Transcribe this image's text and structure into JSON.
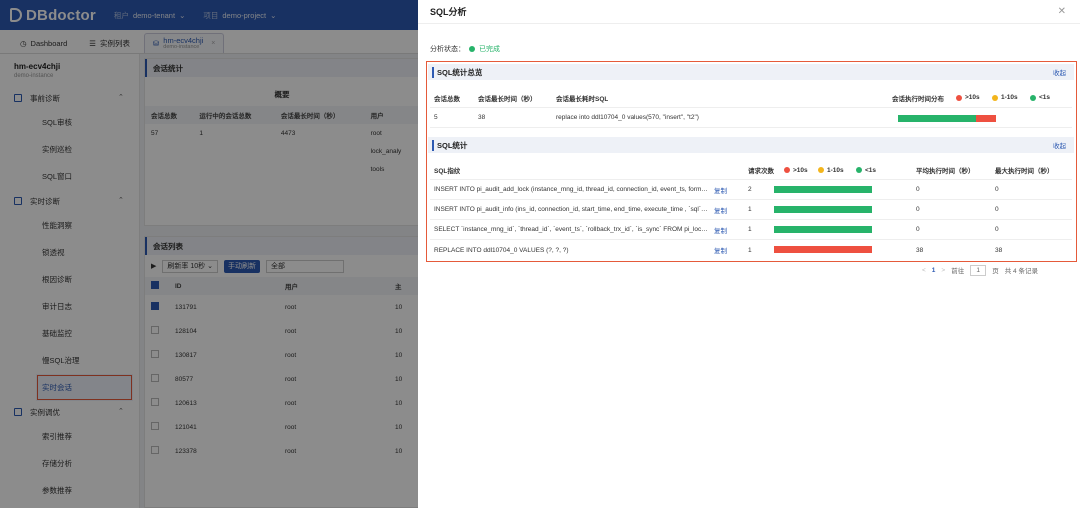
{
  "app": {
    "logo": "DBdoctor",
    "tenant_label": "租户",
    "tenant": "demo-tenant",
    "project_label": "项目",
    "project": "demo-project",
    "tabs": [
      {
        "label": "Dashboard"
      },
      {
        "label": "实例列表"
      },
      {
        "label": "hm-ecv4chji",
        "sub": "demo-instance"
      }
    ]
  },
  "sidebar": {
    "instance_name": "hm-ecv4chji",
    "instance_sub": "demo-instance",
    "groups": [
      {
        "label": "事前诊断",
        "items": [
          "SQL审核",
          "实例巡检",
          "SQL窗口"
        ]
      },
      {
        "label": "实时诊断",
        "items": [
          "性能洞察",
          "锁透视",
          "根因诊断",
          "审计日志",
          "基础监控",
          "慢SQL治理",
          "实时会话"
        ]
      },
      {
        "label": "实例调优",
        "items": [
          "索引推荐",
          "存储分析",
          "参数推荐"
        ]
      }
    ],
    "active_item": "实时会话"
  },
  "session_stats": {
    "title": "会话统计",
    "overview_label": "概要",
    "headers": [
      "会话总数",
      "运行中的会话总数",
      "会话最长时间（秒）",
      "用户"
    ],
    "values": [
      "57",
      "1",
      "4473",
      "root"
    ],
    "users": [
      "root",
      "lock_analy",
      "tools"
    ]
  },
  "session_list": {
    "title": "会话列表",
    "refresh_select": "刷新率 10秒",
    "manual_refresh": "手动刷新",
    "filter_select": "全部",
    "headers": [
      "ID",
      "用户",
      "主"
    ],
    "rows": [
      {
        "id": "131791",
        "user": "root",
        "host": "10",
        "checked": true
      },
      {
        "id": "128104",
        "user": "root",
        "host": "10",
        "checked": false
      },
      {
        "id": "130817",
        "user": "root",
        "host": "10",
        "checked": false
      },
      {
        "id": "80577",
        "user": "root",
        "host": "10",
        "checked": false
      },
      {
        "id": "120613",
        "user": "root",
        "host": "10",
        "checked": false
      },
      {
        "id": "121041",
        "user": "root",
        "host": "10",
        "checked": false
      },
      {
        "id": "123378",
        "user": "root",
        "host": "10",
        "checked": false
      }
    ]
  },
  "modal": {
    "title": "SQL分析",
    "status_label": "分析状态：",
    "status_value": "已完成",
    "overview": {
      "title": "SQL统计总览",
      "collapse": "收起",
      "headers": [
        "会话总数",
        "会话最长时间（秒）",
        "会话最长耗时SQL",
        "会话执行时间分布"
      ],
      "legend": [
        ">10s",
        "1-10s",
        "<1s"
      ],
      "row": {
        "total": "5",
        "max_time": "38",
        "sql": "replace into ddl10704_0 values(570, \"insert\", \"t2\")",
        "dist": {
          "green": 0.8,
          "red": 0.2
        }
      }
    },
    "sql_stats": {
      "title": "SQL统计",
      "collapse": "收起",
      "headers": [
        "SQL指纹",
        "请求次数",
        "平均执行时间（秒）",
        "最大执行时间（秒）"
      ],
      "copy_label": "复制",
      "rows": [
        {
          "sql": "INSERT INTO pi_audit_add_lock (instance_mng_id, thread_id, connection_id, event_ts, forma...",
          "count": "2",
          "avg": "0",
          "max": "0",
          "bar": "green"
        },
        {
          "sql": "INSERT INTO pi_audit_info (ins_id, connection_id, start_time, end_time, execute_time , `sql`, ...",
          "count": "1",
          "avg": "0",
          "max": "0",
          "bar": "green"
        },
        {
          "sql": "SELECT `instance_mng_id`, `thread_id`, `event_ts`, `rollback_trx_id`, `is_sync` FROM pi_lock_d...",
          "count": "1",
          "avg": "0",
          "max": "0",
          "bar": "green"
        },
        {
          "sql": "REPLACE INTO ddl10704_0 VALUES (?, ?, ?)",
          "count": "1",
          "avg": "38",
          "max": "38",
          "bar": "red"
        }
      ]
    },
    "pager": {
      "prev": "<",
      "page": "1",
      "next": ">",
      "goto_label": "前往",
      "goto_value": "1",
      "page_suffix": "页",
      "total": "共 4 条记录"
    },
    "colors": {
      "green": "#27b36a",
      "red": "#ee5040",
      "yellow": "#f3b51c",
      "accent": "#2d5ab2"
    }
  }
}
